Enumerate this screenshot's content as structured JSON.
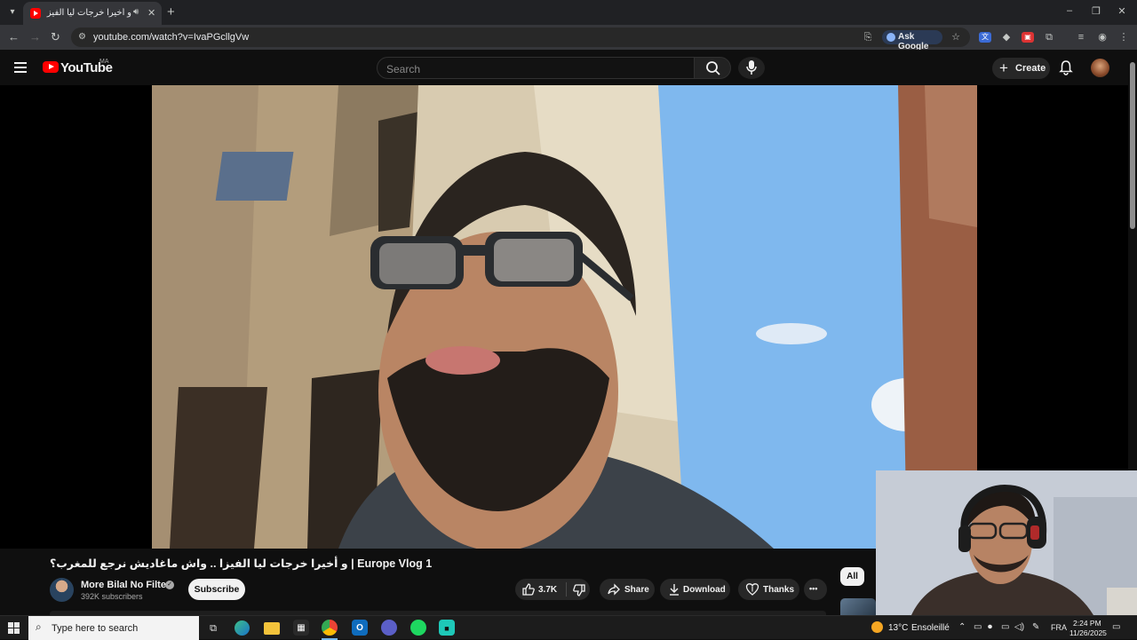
{
  "browser": {
    "tab": {
      "title": "و أخيرا خرجات ليا الفيزا .. واش",
      "favicon_icon": "youtube-icon",
      "audio_icon": "speaker-icon",
      "close_glyph": "✕"
    },
    "new_tab_glyph": "+",
    "url": "youtube.com/watch?v=IvaPGcllgVw",
    "ask_google_label": "Ask Google",
    "window_controls": {
      "minimize": "–",
      "restore": "❐",
      "close": "✕"
    }
  },
  "youtube": {
    "logo_text": "YouTube",
    "region": "MA",
    "search": {
      "placeholder": "Search"
    },
    "create_label": "Create"
  },
  "video": {
    "title": "و أخيرا خرجات ليا الفيزا .. واش ماغاديش نرجع للمغرب؟ | Europe Vlog 1",
    "channel": {
      "name": "More Bilal No Filter",
      "verified": true,
      "subscribers": "392K subscribers"
    },
    "subscribe_label": "Subscribe",
    "likes": "3.7K",
    "actions": {
      "share": "Share",
      "download": "Download",
      "thanks": "Thanks",
      "more": "•••"
    }
  },
  "recommendations": {
    "chips": [
      "All"
    ]
  },
  "taskbar": {
    "search_placeholder": "Type here to search",
    "weather": {
      "temp": "13°C",
      "desc": "Ensoleillé"
    },
    "language": "FRA",
    "time": "2:24 PM",
    "date": "11/26/2025",
    "apps": [
      "task-view-icon",
      "edge-icon",
      "file-explorer-icon",
      "store-icon",
      "chrome-icon",
      "outlook-icon",
      "teams-icon",
      "spotify-icon",
      "capcut-icon"
    ]
  },
  "colors": {
    "yt_red": "#ff0000",
    "bg": "#0f0f0f",
    "pill": "#272727",
    "taskbar": "#1c1c1c"
  }
}
